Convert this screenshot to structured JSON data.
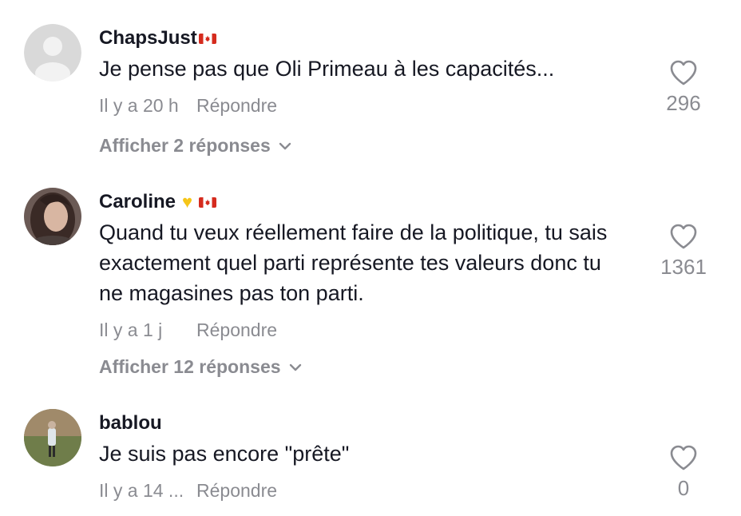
{
  "comments": [
    {
      "username": "ChapsJust",
      "text": "Je pense pas que Oli Primeau à les capacités...",
      "time": "Il y a 20 h",
      "reply_label": "Répondre",
      "likes": "296",
      "show_replies": "Afficher 2 réponses"
    },
    {
      "username": "Caroline",
      "text": "Quand tu veux réellement faire de la politique, tu sais exactement quel parti représente tes valeurs donc tu ne magasines pas ton parti.",
      "time": "Il y a 1 j",
      "reply_label": "Répondre",
      "likes": "1361",
      "show_replies": "Afficher 12 réponses"
    },
    {
      "username": "bablou",
      "text": "Je suis pas encore \"prête\"",
      "time": "Il y a 14 ...",
      "reply_label": "Répondre",
      "likes": "0"
    }
  ],
  "colors": {
    "primary_text": "#161823",
    "secondary_text": "#8a8b91",
    "flag_red": "#d52b1e",
    "heart_emoji": "#f5c518"
  },
  "icons": {
    "like": "heart-outline-icon",
    "expand": "chevron-down-icon",
    "flag": "canada-flag-icon",
    "emoji": "yellow-heart-emoji-icon"
  }
}
